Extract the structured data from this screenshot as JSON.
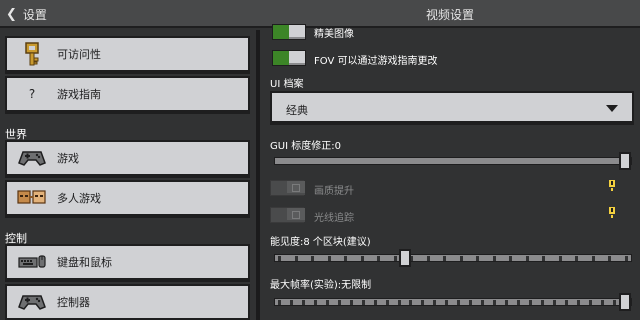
{
  "topbar": {
    "back_label": "设置",
    "title": "视频设置"
  },
  "sidebar": {
    "items": [
      {
        "label": "可访问性",
        "icon": "key-icon"
      },
      {
        "label": "游戏指南",
        "icon": "question-icon",
        "glyph": "?"
      }
    ],
    "sections": [
      {
        "title": "世界",
        "items": [
          {
            "label": "游戏",
            "icon": "controller-icon"
          },
          {
            "label": "多人游戏",
            "icon": "multiplayer-icon"
          }
        ]
      },
      {
        "title": "控制",
        "items": [
          {
            "label": "键盘和鼠标",
            "icon": "keyboard-mouse-icon"
          },
          {
            "label": "控制器",
            "icon": "controller-icon"
          }
        ]
      }
    ]
  },
  "main": {
    "toggles": [
      {
        "label": "精美图像",
        "state": "on"
      },
      {
        "label": "FOV 可以通过游戏指南更改",
        "state": "on"
      }
    ],
    "ui_profile": {
      "label": "UI 档案",
      "value": "经典"
    },
    "gui_scale": {
      "label": "GUI 标度修正:0",
      "value_fraction": 1.0
    },
    "disabled_toggles": [
      {
        "label": "画质提升",
        "state": "disabled"
      },
      {
        "label": "光线追踪",
        "state": "disabled"
      }
    ],
    "render_distance": {
      "label": "能见度:8 个区块(建议)",
      "value_fraction": 0.36
    },
    "max_framerate": {
      "label": "最大帧率(实验):无限制",
      "value_fraction": 1.0
    }
  },
  "colors": {
    "background": "#313233",
    "button": "#d0d1d4",
    "toggle_on": "#3c8527",
    "info_yellow": "#f3d03f"
  }
}
